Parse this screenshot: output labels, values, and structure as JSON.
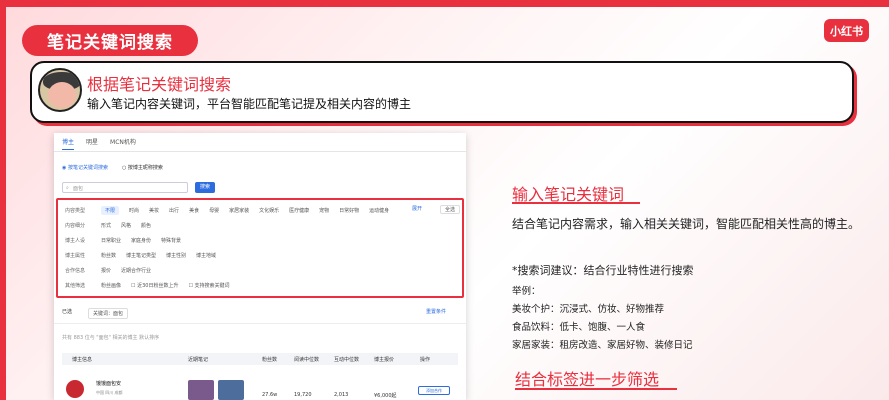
{
  "header": {
    "title": "笔记关键词搜索",
    "logo": "小红书"
  },
  "banner": {
    "title": "根据笔记关键词搜索",
    "desc": "输入笔记内容关键词，平台智能匹配笔记提及相关内容的博主"
  },
  "screenshot": {
    "tabs": [
      "博主",
      "明星",
      "MCN机构"
    ],
    "search_modes": [
      "按笔记关键词搜索",
      "按博主昵称搜索"
    ],
    "search_placeholder": "面包",
    "search_btn": "搜索",
    "filters": [
      {
        "label": "内容类型",
        "items": [
          "不限",
          "时尚",
          "美妆",
          "出行",
          "美食",
          "母婴",
          "家居家装",
          "文化娱乐",
          "医疗健康",
          "宠物",
          "日常好物",
          "运动健身"
        ]
      },
      {
        "label": "内容细分",
        "items": [
          "形式",
          "风格",
          "颜色"
        ]
      },
      {
        "label": "博主人设",
        "items": [
          "日常职业",
          "家庭身份",
          "特殊背景"
        ]
      },
      {
        "label": "博主属性",
        "items": [
          "粉丝数",
          "博主笔记类型",
          "博主性别",
          "博主地域"
        ]
      },
      {
        "label": "合作信息",
        "items": [
          "报价",
          "近期合作行业"
        ]
      },
      {
        "label": "其他筛选",
        "items": [
          "粉丝画像",
          "近30日粉丝数上升",
          "支持搜索关键词"
        ]
      }
    ],
    "expand": "展开",
    "select": "全选",
    "chosen_label": "已选",
    "chosen_tags": [
      "关键词：面包"
    ],
    "clear": "重置条件",
    "meta": "共有 883 位与 \"面包\" 相关的博主     默认排序",
    "columns": [
      "博主信息",
      "近期笔记",
      "粉丝数",
      "阅读中位数",
      "互动中位数",
      "博主报价",
      "操作"
    ],
    "row": {
      "name": "饿饿面包安",
      "loc": "中国 四川 成都",
      "fans": "27.6w",
      "read": "19,720",
      "interact": "2,013",
      "price": "¥6,000起",
      "action": "添加合作"
    }
  },
  "right": {
    "h1": "输入笔记关键词",
    "p1": "结合笔记内容需求，输入相关关键词，智能匹配相关性高的博主。",
    "p2": "*搜索词建议：结合行业特性进行搜索",
    "list": [
      "举例：",
      "美妆个护：沉浸式、仿妆、好物推荐",
      "食品饮料：低卡、饱腹、一人食",
      "家居家装：租房改造、家居好物、装修日记"
    ],
    "h2": "结合标签进一步筛选"
  },
  "colors": {
    "accent": "#e8303f",
    "blue": "#2d6cdf"
  }
}
